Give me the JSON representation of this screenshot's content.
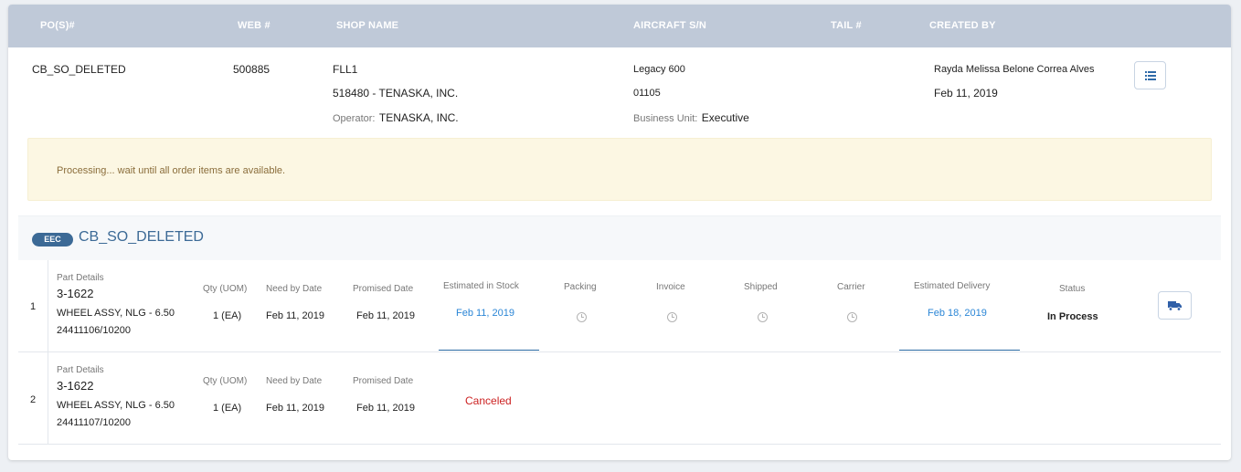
{
  "header": {
    "pos": "PO(S)#",
    "web": "WEB #",
    "shop": "SHOP NAME",
    "aircraft": "AIRCRAFT S/N",
    "tail": "TAIL #",
    "created_by": "CREATED BY"
  },
  "summary": {
    "po": "CB_SO_DELETED",
    "web": "500885",
    "shop_name": "FLL1",
    "shop_account": "518480 - TENASKA, INC.",
    "operator_label": "Operator:",
    "operator_value": "TENASKA, INC.",
    "aircraft_model": "Legacy 600",
    "aircraft_sn": "01105",
    "business_unit_label": "Business Unit:",
    "business_unit_value": "Executive",
    "created_by_name": "Rayda Melissa Belone Correa Alves",
    "created_date": "Feb 11, 2019"
  },
  "alert": {
    "message": "Processing... wait until all order items are available."
  },
  "order": {
    "badge": "EEC",
    "title": "CB_SO_DELETED"
  },
  "labels": {
    "part_details": "Part Details",
    "qty": "Qty (UOM)",
    "need_by": "Need by Date",
    "promised": "Promised Date",
    "est_stock": "Estimated in Stock",
    "packing": "Packing",
    "invoice": "Invoice",
    "shipped": "Shipped",
    "carrier": "Carrier",
    "est_delivery": "Estimated Delivery",
    "status": "Status"
  },
  "items": [
    {
      "num": "1",
      "part_number": "3-1622",
      "description": "WHEEL ASSY, NLG - 6.50",
      "ref": "24411106/10200",
      "qty": "1 (EA)",
      "need_by": "Feb 11, 2019",
      "promised": "Feb 11, 2019",
      "est_stock": "Feb 11, 2019",
      "est_delivery": "Feb 18, 2019",
      "status": "In Process"
    },
    {
      "num": "2",
      "part_number": "3-1622",
      "description": "WHEEL ASSY, NLG - 6.50",
      "ref": "24411107/10200",
      "qty": "1 (EA)",
      "need_by": "Feb 11, 2019",
      "promised": "Feb 11, 2019",
      "state": "Canceled"
    }
  ],
  "icons": {
    "list": "list-icon",
    "truck": "truck-icon",
    "clock": "clock-icon"
  },
  "colors": {
    "header_bg": "#bfc9d8",
    "accent_blue": "#2b86d6",
    "badge": "#3c6a96",
    "alert_bg": "#fcf7e3",
    "cancel_red": "#cc2222"
  }
}
